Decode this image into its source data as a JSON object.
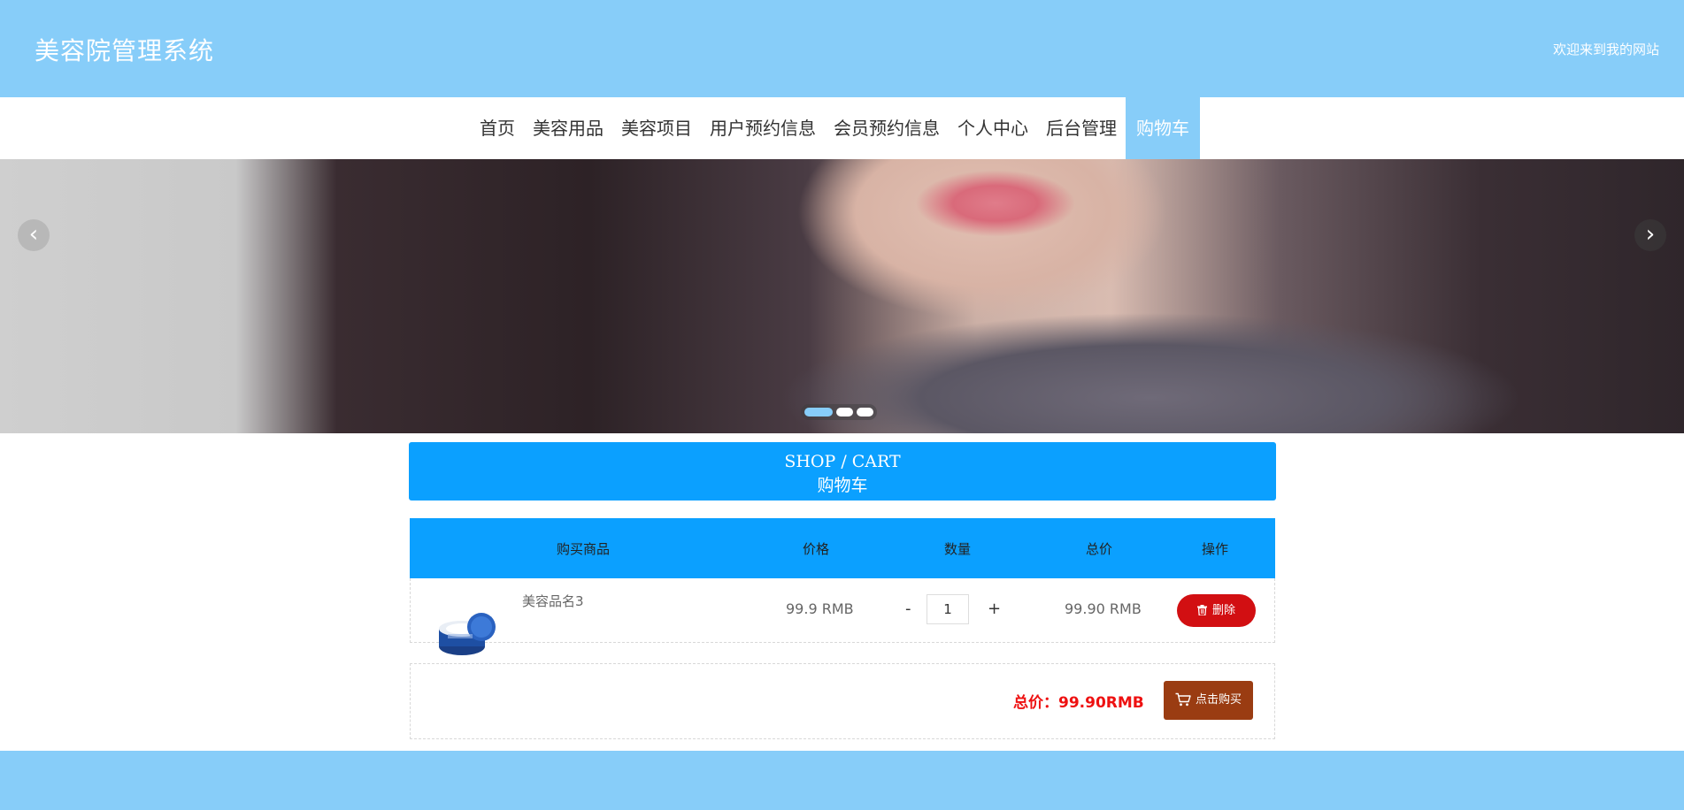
{
  "header": {
    "site_title": "美容院管理系统",
    "welcome": "欢迎来到我的网站"
  },
  "nav": {
    "items": [
      {
        "label": "首页"
      },
      {
        "label": "美容用品"
      },
      {
        "label": "美容项目"
      },
      {
        "label": "用户预约信息"
      },
      {
        "label": "会员预约信息"
      },
      {
        "label": "个人中心"
      },
      {
        "label": "后台管理"
      },
      {
        "label": "购物车",
        "active": true
      }
    ]
  },
  "banner": {
    "prev_icon": "chevron-left-icon",
    "next_icon": "chevron-right-icon",
    "slides": 3,
    "active_slide": 1
  },
  "section": {
    "title_en": "SHOP / CART",
    "title_cn": "购物车"
  },
  "cart": {
    "headers": [
      "购买商品",
      "价格",
      "数量",
      "总价",
      "操作"
    ],
    "items": [
      {
        "name": "美容品名3",
        "price": "99.9 RMB",
        "minus": "-",
        "quantity": "1",
        "plus": "+",
        "total": "99.90 RMB",
        "delete_label": "删除"
      }
    ],
    "summary_label": "总价：",
    "summary_value": "99.90RMB",
    "buy_label": "点击购买"
  },
  "colors": {
    "header_bg": "#87cdf9",
    "primary_blue": "#0ba0ff",
    "delete_red": "#d20f12",
    "buy_brown": "#9a3c12",
    "total_red": "#ee1111"
  }
}
